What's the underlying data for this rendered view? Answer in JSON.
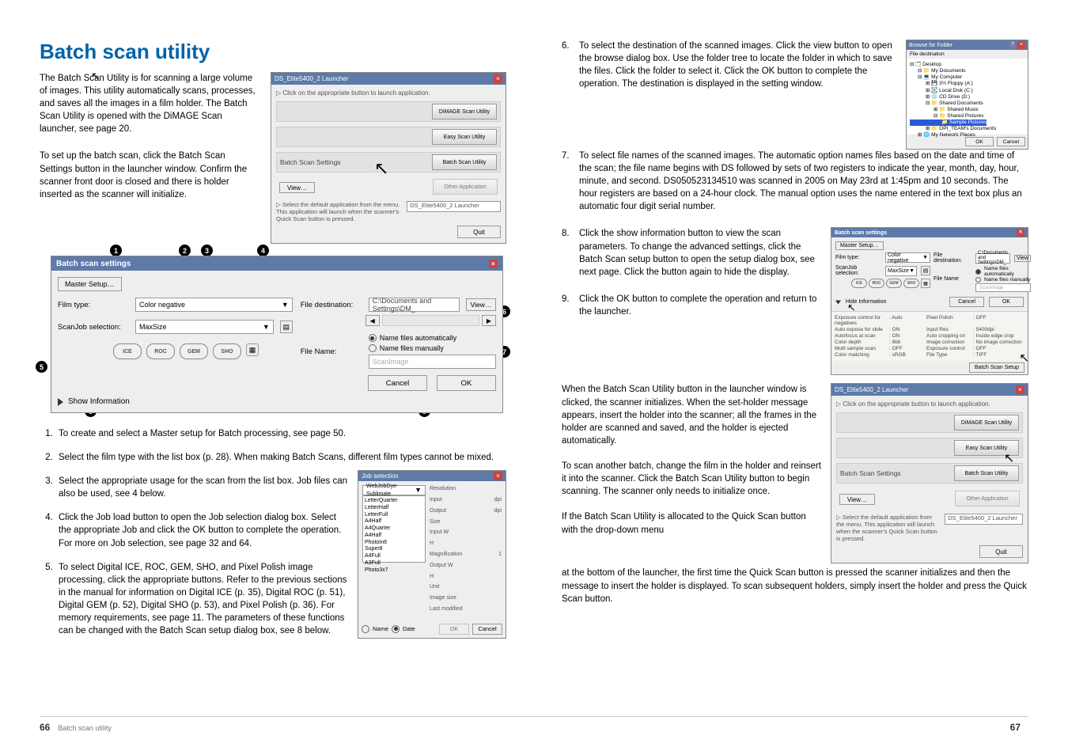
{
  "title": "Batch scan utility",
  "intro_p1": "The Batch Scan Utility is for scanning a large volume of images. This utility automatically scans, processes, and saves all the images in a film holder. The Batch Scan Utility is opened with the DiMAGE Scan launcher, see page 20.",
  "intro_p2": "To set up the batch scan, click the Batch Scan Settings button in the launcher window. Confirm the scanner front door is closed and there is holder inserted as the scanner will initialize.",
  "launcher": {
    "title": "DS_Elite5400_2 Launcher",
    "hint": "▷ Click on the appropriate button to launch application.",
    "rows": [
      "DiMAGE Scan Utility",
      "Easy Scan Utility",
      "Batch Scan Utility",
      "Other Application"
    ],
    "row3_left": "Batch Scan Settings",
    "view": "View…",
    "note": "▷ Select the default application from the menu. This application will launch when the scanner's Quick Scan button is pressed.",
    "dd": "DS_Elite5400_2 Launcher",
    "quit": "Quit"
  },
  "settings": {
    "title": "Batch scan settings",
    "master": "Master Setup…",
    "film_type_lbl": "Film type:",
    "film_type_val": "Color negative",
    "job_lbl": "ScanJob selection:",
    "job_val": "MaxSize",
    "tools": [
      "ICE",
      "ROC",
      "GEM",
      "SHO"
    ],
    "file_dest_lbl": "File destination:",
    "file_dest_val": "C:\\Documents and Settings\\DM_",
    "view": "View…",
    "file_name_lbl": "File Name:",
    "radio1": "Name files automatically",
    "radio2": "Name files manually",
    "tb": "ScanImage",
    "cancel": "Cancel",
    "ok": "OK",
    "show_info": "Show Information"
  },
  "steps_left": [
    "To create and select a Master setup for Batch processing, see page 50.",
    "Select the film type with the list box (p. 28). When making Batch Scans, different film types cannot be mixed.",
    "Select the appropriate usage for the scan from the list box. Job files can also be used, see 4 below.",
    "Click the Job load button to open the Job selection dialog box. Select the appropriate Job and click the OK button to complete the operation. For more on Job selection, see page 32 and 64.",
    "To select Digital ICE, ROC, GEM, SHO, and Pixel Polish image processing, click the appropriate buttons. Refer to the previous sections in the manual for information on Digital ICE (p. 35), Digital ROC (p. 51), Digital GEM (p. 52), Digital SHO (p. 53), and Pixel Polish (p. 36). For memory requirements, see page 11. The parameters of these functions can be changed with the Batch Scan setup dialog box, see 8 below."
  ],
  "jobsel": {
    "title": "Job selection",
    "cat_dd": "WebJobDye-Sublimate",
    "items": [
      "LetterQuarter",
      "LetterHalf",
      "LetterFull",
      "A4Half",
      "A4Quarter",
      "A4Half",
      "PhotoIn6",
      "Super8",
      "A4Full",
      "A3Full",
      "Photo3x7"
    ],
    "props": [
      "Resolution",
      "Input",
      "Output",
      "Size",
      "Input W",
      "H",
      "Magnification",
      "Output W",
      "H",
      "Unit",
      "Image size",
      "Last modified"
    ],
    "dpi": "dpi",
    "name": "Name",
    "date": "Date",
    "ok": "OK",
    "cancel": "Cancel"
  },
  "steps_right": {
    "s6": "To select the destination of the scanned images. Click the view button to open the browse dialog box. Use the folder tree to locate the folder in which to save the files. Click the folder to select it. Click the OK button to complete the operation. The destination is displayed in the setting window.",
    "s7": "To select file names of the scanned images. The automatic option names files based on the date and time of the scan; the file name begins with DS followed by sets of two registers to indicate the year, month, day, hour, minute, and second. DS050523134510 was scanned in 2005 on May 23rd at 1:45pm and 10 seconds. The hour registers are based on a 24-hour clock. The manual option uses the name entered in the text box plus an automatic four digit serial number.",
    "s8": "Click the show information button to view the scan parameters. To change the advanced settings, click the Batch Scan setup button to open the setup dialog box, see next page. Click the button again to hide the display.",
    "s9": "Click the OK button to complete the operation and return to the launcher."
  },
  "right_para1": "When the Batch Scan Utility button in the launcher window is clicked, the scanner initializes. When the set-holder message appears, insert the holder into the scanner; all the frames in the holder are scanned and saved, and the holder is ejected automatically.",
  "right_para2": "To scan another batch, change the film in the holder and reinsert it into the scanner. Click the Batch Scan Utility button to begin scanning. The scanner only needs to initialize once.",
  "right_para3": "If the Batch Scan Utility is allocated to the Quick Scan button with the drop-down menu at the bottom of the launcher, the first time the Quick Scan button is pressed the scanner initializes and then the message to insert the holder is displayed. To scan subsequent holders, simply insert the holder and press the Quick Scan button.",
  "browse": {
    "title": "Browse for Folder",
    "hdr": "File destination",
    "tree": [
      "Desktop",
      "My Documents",
      "My Computer",
      "3½ Floppy (A:)",
      "Local Disk (C:)",
      "CD Drive (D:)",
      "Shared Documents",
      "Shared Music",
      "Shared Pictures",
      "Sample Pictures",
      "OPI_TEAM's Documents",
      "My Network Places"
    ],
    "ok": "OK",
    "cancel": "Cancel"
  },
  "infowin": {
    "title": "Batch scan settings",
    "master": "Master Setup…",
    "film_type_lbl": "Film type:",
    "film_type_val": "Color negative",
    "job_lbl": "ScanJob selection:",
    "job_val": "MaxSize",
    "file_dest_lbl": "File destination:",
    "file_name_lbl": "File Name",
    "file_dest": "C:\\Documents and Settings\\DM_",
    "radio1": "Name files automatically",
    "radio2": "Name files manually",
    "tb": "ScanImage",
    "hide": "Hide Information",
    "cancel": "Cancel",
    "ok": "OK",
    "rows": [
      [
        "Exposure control for negatives",
        ": Auto",
        "Pixel Polish",
        ": OFF"
      ],
      [
        "Auto expose for slide",
        ": ON",
        "Input Res",
        ": 5400dpi"
      ],
      [
        "Autofocus at scan",
        ": ON",
        "Auto cropping on",
        ": Inside edge crop"
      ],
      [
        "Color depth",
        ": 8bit",
        "Image correction",
        ": No image correction"
      ],
      [
        "Multi sample scan",
        ": OFF",
        "Exposure control",
        ": OFF"
      ],
      [
        "Color matching",
        ": sRGB",
        "File Type",
        ": TIFF"
      ]
    ],
    "setup": "Batch Scan Setup"
  },
  "footer": {
    "left_num": "66",
    "left_lbl": "Batch scan utility",
    "right_num": "67"
  }
}
